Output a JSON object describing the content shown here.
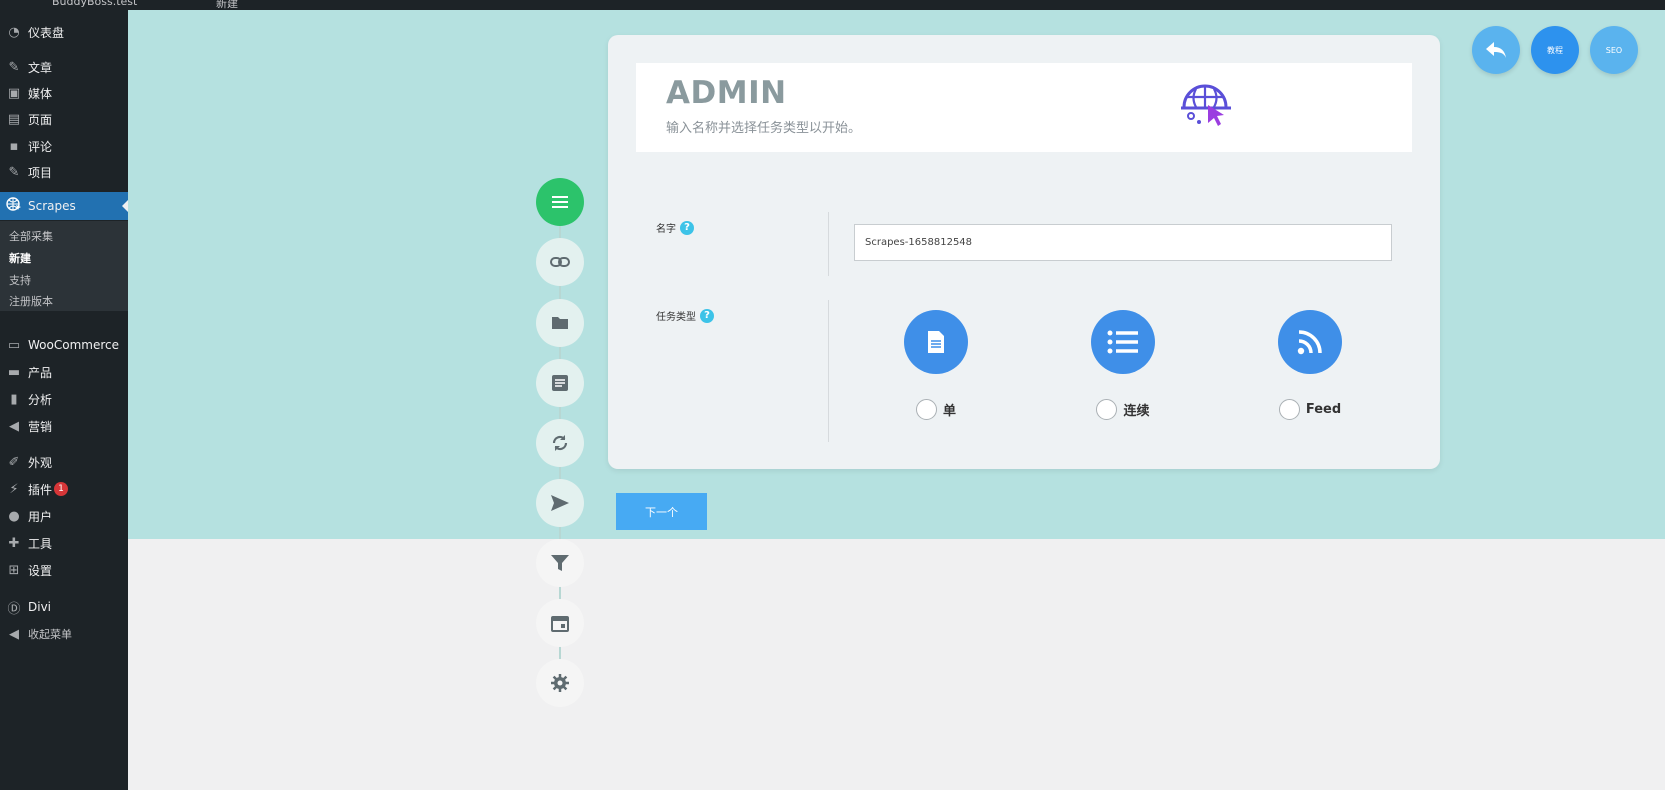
{
  "adminbar": {
    "site_name": "BuddyBoss.test",
    "new_label": "新建"
  },
  "sidebar": {
    "items": [
      {
        "label": "仪表盘",
        "icon": "dashboard-icon"
      },
      {
        "label": "文章",
        "icon": "pin-icon"
      },
      {
        "label": "媒体",
        "icon": "media-icon"
      },
      {
        "label": "页面",
        "icon": "page-icon"
      },
      {
        "label": "评论",
        "icon": "comment-icon"
      },
      {
        "label": "项目",
        "icon": "pin-icon"
      },
      {
        "label": "Scrapes",
        "icon": "globe-cursor-icon"
      },
      {
        "label": "WooCommerce",
        "icon": "woo-icon"
      },
      {
        "label": "产品",
        "icon": "archive-icon"
      },
      {
        "label": "分析",
        "icon": "bar-chart-icon"
      },
      {
        "label": "营销",
        "icon": "megaphone-icon"
      },
      {
        "label": "外观",
        "icon": "brush-icon"
      },
      {
        "label": "插件",
        "icon": "plugin-icon",
        "badge": "1"
      },
      {
        "label": "用户",
        "icon": "user-icon"
      },
      {
        "label": "工具",
        "icon": "wrench-icon"
      },
      {
        "label": "设置",
        "icon": "settings-icon"
      },
      {
        "label": "Divi",
        "icon": "divi-icon"
      },
      {
        "label": "收起菜单",
        "icon": "collapse-icon"
      }
    ],
    "submenu": [
      "全部采集",
      "新建",
      "支持",
      "注册版本"
    ]
  },
  "header": {
    "title": "ADMIN",
    "subtitle": "输入名称并选择任务类型以开始。"
  },
  "form": {
    "name_label": "名字",
    "name_value": "Scrapes-1658812548",
    "type_label": "任务类型",
    "types": [
      {
        "label": "单",
        "icon": "document-icon"
      },
      {
        "label": "连续",
        "icon": "list-icon"
      },
      {
        "label": "Feed",
        "icon": "rss-icon"
      }
    ],
    "help_glyph": "?"
  },
  "next_button": "下一个",
  "top_buttons": {
    "tutorial": "教程",
    "seo": "SEO"
  },
  "colors": {
    "teal_bg": "#b5e1e0",
    "accent_blue": "#3f8fe8",
    "step_active": "#2cc36b",
    "wp_blue": "#2271b1"
  }
}
